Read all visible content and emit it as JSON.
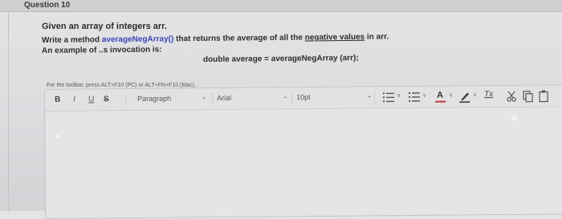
{
  "question": {
    "title": "Question 10"
  },
  "prompt": {
    "line1": "Given an array of integers arr.",
    "line2_prefix": "Write a method ",
    "line2_method": "averageNegArray()",
    "line2_middle": " that returns the average of all the ",
    "line2_underlined": "negative values",
    "line2_suffix": " in arr.",
    "line3": "An example of ..s invocation is:",
    "code": "double average = averageNegArray (arr);"
  },
  "editor": {
    "toolbar_hint": "For the toolbar, press ALT+F10 (PC) or ALT+FN+F10 (Mac).",
    "bold_label": "B",
    "italic_label": "I",
    "underline_label": "U",
    "strike_label": "S",
    "paragraph_value": "Paragraph",
    "font_value": "Arial",
    "size_value": "10pt",
    "dropdown_chevron": "⌄",
    "mini_chevron": "∨",
    "text_color_letter": "A",
    "clear_format_label": "Tx",
    "icons": [
      "ordered-list-icon",
      "unordered-list-icon",
      "text-color-icon",
      "highlight-pen-icon",
      "clear-formatting-icon",
      "cut-icon",
      "copy-icon",
      "paste-icon"
    ],
    "accent_blue": "#3b47b8",
    "accent_red": "#c23a3a"
  }
}
